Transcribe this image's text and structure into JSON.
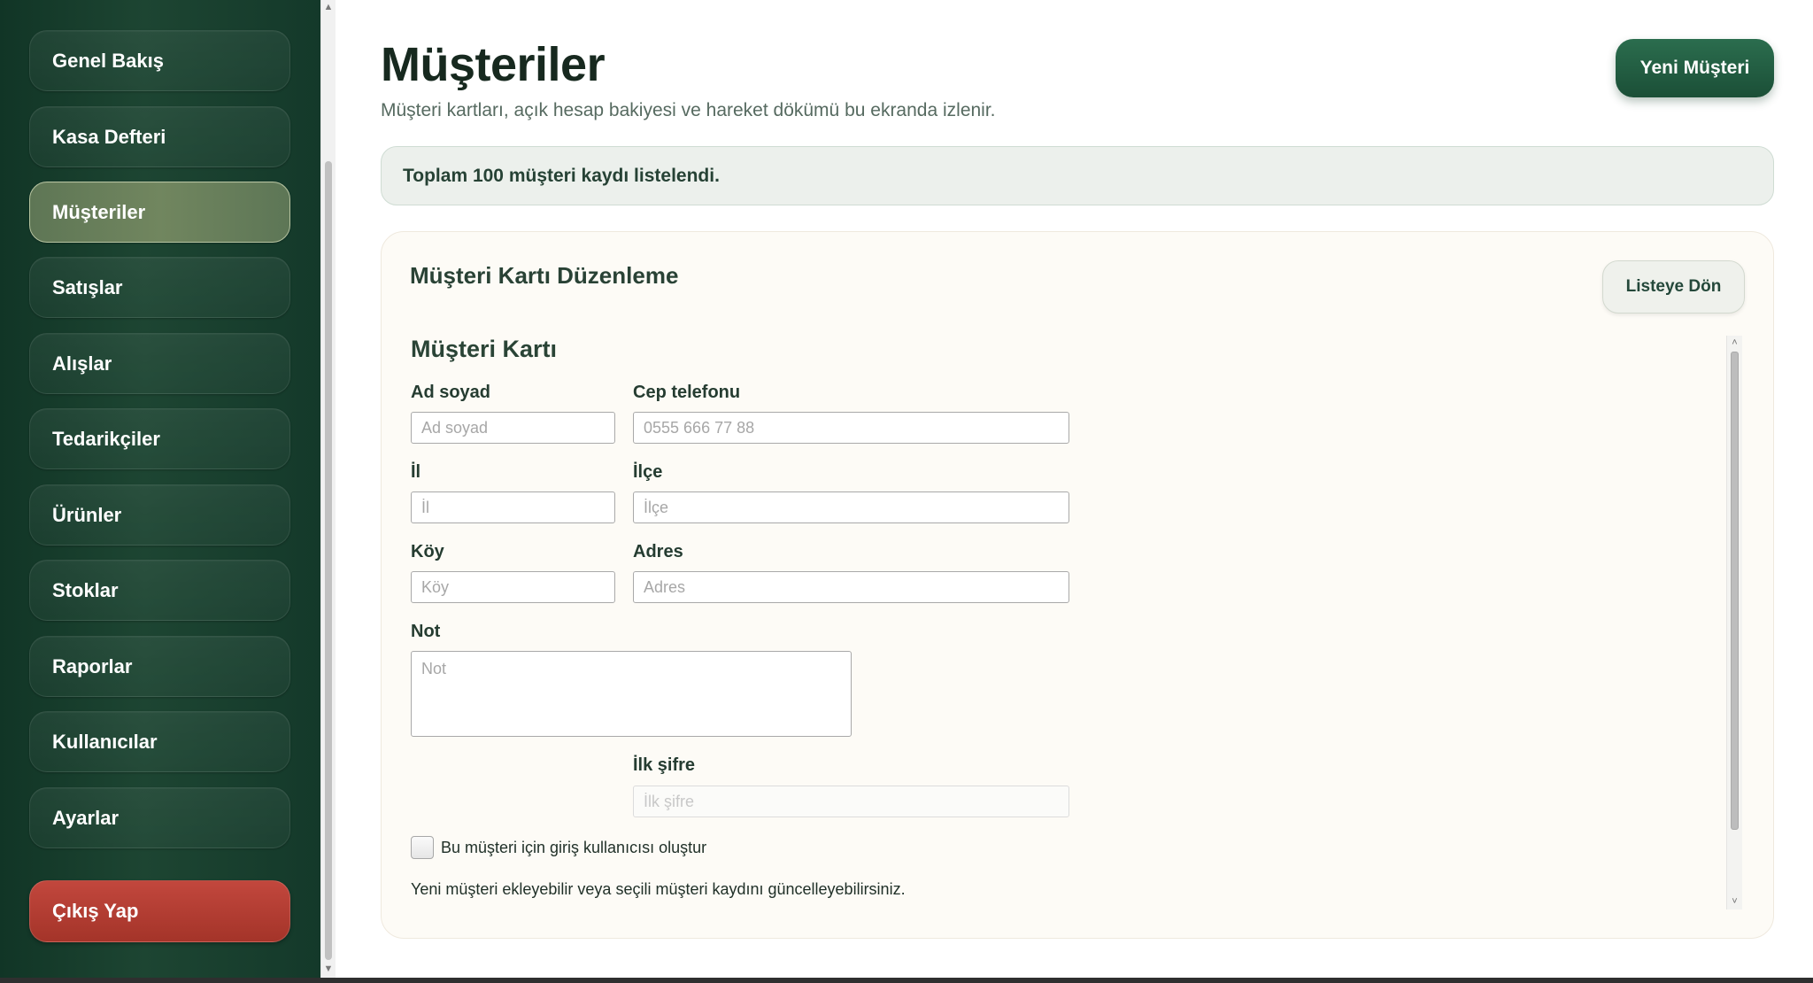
{
  "sidebar": {
    "items": [
      {
        "label": "Genel Bakış"
      },
      {
        "label": "Kasa Defteri"
      },
      {
        "label": "Müşteriler"
      },
      {
        "label": "Satışlar"
      },
      {
        "label": "Alışlar"
      },
      {
        "label": "Tedarikçiler"
      },
      {
        "label": "Ürünler"
      },
      {
        "label": "Stoklar"
      },
      {
        "label": "Raporlar"
      },
      {
        "label": "Kullanıcılar"
      },
      {
        "label": "Ayarlar"
      }
    ],
    "active_index": 2,
    "logout_label": "Çıkış Yap"
  },
  "header": {
    "title": "Müşteriler",
    "subtitle": "Müşteri kartları, açık hesap bakiyesi ve hareket dökümü bu ekranda izlenir.",
    "new_button": "Yeni Müşteri"
  },
  "info": {
    "text": "Toplam 100 müşteri kaydı listelendi."
  },
  "card": {
    "title": "Müşteri Kartı Düzenleme",
    "back_button": "Listeye Dön",
    "form_title": "Müşteri Kartı",
    "fields": {
      "name": {
        "label": "Ad soyad",
        "placeholder": "Ad soyad",
        "value": ""
      },
      "phone": {
        "label": "Cep telefonu",
        "placeholder": "0555 666 77 88",
        "value": ""
      },
      "city": {
        "label": "İl",
        "placeholder": "İl",
        "value": ""
      },
      "district": {
        "label": "İlçe",
        "placeholder": "İlçe",
        "value": ""
      },
      "village": {
        "label": "Köy",
        "placeholder": "Köy",
        "value": ""
      },
      "address": {
        "label": "Adres",
        "placeholder": "Adres",
        "value": ""
      },
      "note": {
        "label": "Not",
        "placeholder": "Not",
        "value": ""
      },
      "initial_password": {
        "label": "İlk şifre",
        "placeholder": "İlk şifre",
        "value": ""
      }
    },
    "create_login_label": "Bu müşteri için giriş kullanıcısı oluştur",
    "create_login_checked": false,
    "help_text": "Yeni müşteri ekleyebilir veya seçili müşteri kaydını güncelleyebilirsiniz."
  },
  "colors": {
    "sidebar_bg": "#1d4532",
    "active_item": "#71865f",
    "primary_button": "#1b4f37",
    "logout_button": "#b03b30",
    "card_bg": "#fdfbf6",
    "info_bg": "#ecf0ec"
  }
}
